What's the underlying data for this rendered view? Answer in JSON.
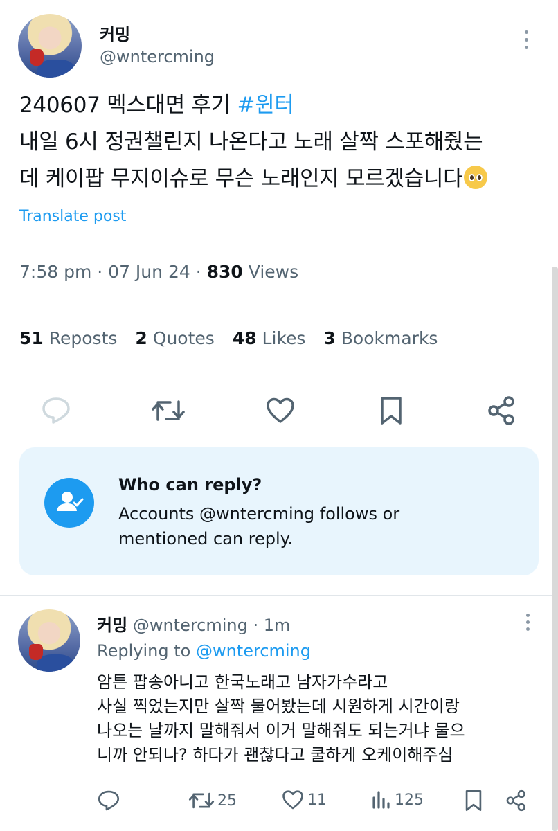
{
  "main_tweet": {
    "display_name": "커밍",
    "handle": "@wntercming",
    "text_line1_prefix": "240607 멕스대면 후기 ",
    "hashtag": "#윈터",
    "text_line2": "내일 6시 정권챌린지 나온다고 노래 살짝 스포해줬는",
    "text_line3": "데 케이팝 무지이슈로 무슨 노래인지 모르겠습니다",
    "emoji": "pleading-face-emoji",
    "translate_label": "Translate post",
    "time": "7:58 pm",
    "date": "07 Jun 24",
    "views_count": "830",
    "views_label": "Views",
    "separator": "·"
  },
  "stats": [
    {
      "count": "51",
      "label": "Reposts"
    },
    {
      "count": "2",
      "label": "Quotes"
    },
    {
      "count": "48",
      "label": "Likes"
    },
    {
      "count": "3",
      "label": "Bookmarks"
    }
  ],
  "actions": [
    "reply-icon",
    "repost-icon",
    "like-icon",
    "bookmark-icon",
    "share-icon"
  ],
  "who_can_reply": {
    "title": "Who can reply?",
    "desc_line1": "Accounts @wntercming follows or",
    "desc_line2": "mentioned can reply."
  },
  "reply_tweet": {
    "display_name": "커밍",
    "handle": "@wntercming",
    "time": "1m",
    "replying_to_label": "Replying to",
    "replying_to_handle": "@wntercming",
    "lines": [
      "암튼 팝송아니고 한국노래고 남자가수라고",
      "사실 찍었는지만 살짝 물어봤는데 시원하게 시간이랑",
      "나오는 날까지 말해줘서 이거 말해줘도 되는거냐 물으",
      "니까 안되나? 하다가 괜찮다고 쿨하게 오케이해주심"
    ],
    "reposts": "25",
    "likes": "11",
    "views": "125"
  },
  "colors": {
    "accent": "#1d9bf0",
    "muted": "#536471",
    "text": "#0f1419",
    "reply_box_bg": "#e8f5fd"
  }
}
